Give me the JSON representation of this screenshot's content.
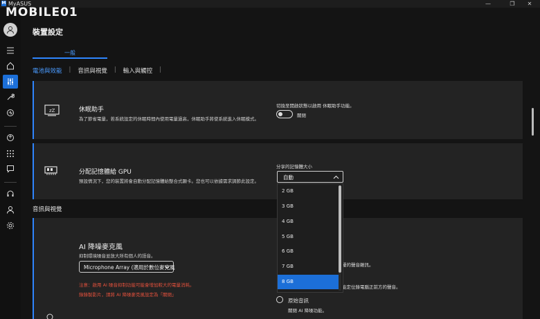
{
  "window": {
    "app_name": "MyASUS",
    "logo_text": "M",
    "minimize": "—",
    "restore": "❐",
    "close": "✕"
  },
  "watermark": "MOBILE01",
  "page_title": "裝置設定",
  "main_tab": "一般",
  "subtabs": [
    {
      "label": "電池與效能"
    },
    {
      "label": "音訊與視覺"
    },
    {
      "label": "輸入與觸控"
    }
  ],
  "subtab_separator": "|",
  "sleep_card": {
    "title": "休眠助手",
    "description": "為了節省電量，若系統設定的休眠時間內使用電量過高，休眠助手將使系統進入休眠模式。",
    "switch_hint": "切換至開啟狀態以啟用 休眠助手功能。",
    "toggle_label": "關閉",
    "toggle_on": false
  },
  "gpu_card": {
    "title": "分配記憶體給 GPU",
    "description": "預設情況下，您的裝置將會自動分配記憶體給整合式顯卡。您也可以依據需求調節此設定。",
    "select_label": "分享的記憶體大小",
    "selected_value": "自動",
    "options": [
      "2 GB",
      "3 GB",
      "4 GB",
      "5 GB",
      "6 GB",
      "7 GB",
      "8 GB"
    ],
    "highlighted_option": "8 GB"
  },
  "audio_section_title": "音訊與視覺",
  "mic_card": {
    "title": "AI 降噪麥克風",
    "description": "抑制環境噪音並放大所有個人的語音。",
    "device_value": "Microphone Array (適用於數位麥克風",
    "warning_1": "注意：啟用 AI 噪音抑制功能可能會增加較大的電量消耗。",
    "warning_2": "錄錄製影片，請將 AI 降噪麥克風設定為「關閉」",
    "right_fragment_1": "擾的聲音雜訊。",
    "right_fragment_2": "能定位錄電腦正前方的聲音。",
    "original_audio_label": "原始音訊",
    "original_audio_desc": "關閉 AI 降噪功能。"
  },
  "colors": {
    "accent": "#1c6fd8",
    "background": "#141414",
    "card": "#232323",
    "warning": "#e0503c"
  }
}
